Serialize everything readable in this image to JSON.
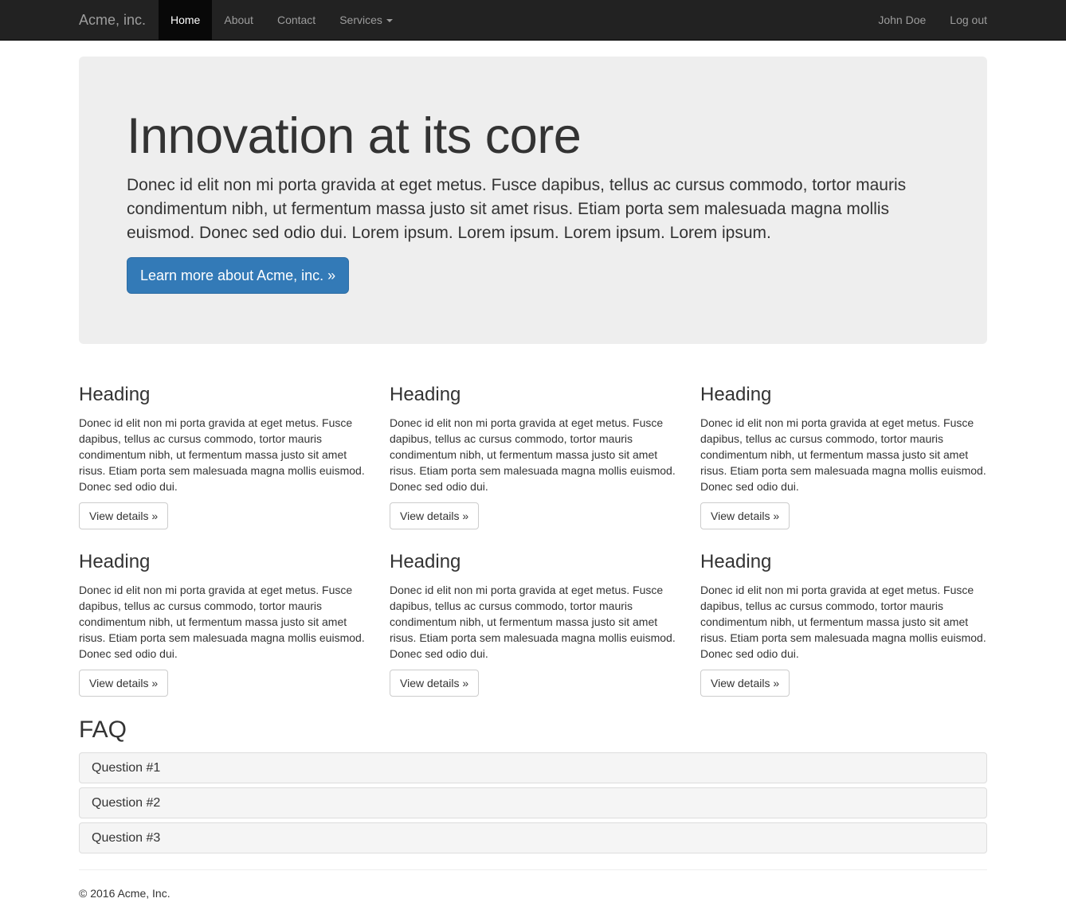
{
  "navbar": {
    "brand": "Acme, inc.",
    "items": [
      {
        "label": "Home"
      },
      {
        "label": "About"
      },
      {
        "label": "Contact"
      },
      {
        "label": "Services"
      }
    ],
    "right_items": [
      {
        "label": "John Doe"
      },
      {
        "label": "Log out"
      }
    ]
  },
  "jumbotron": {
    "title": "Innovation at its core",
    "text": "Donec id elit non mi porta gravida at eget metus. Fusce dapibus, tellus ac cursus commodo, tortor mauris condimentum nibh, ut fermentum massa justo sit amet risus. Etiam porta sem malesuada magna mollis euismod. Donec sed odio dui. Lorem ipsum. Lorem ipsum. Lorem ipsum. Lorem ipsum.",
    "button_label": "Learn more about Acme, inc. »"
  },
  "features": [
    {
      "heading": "Heading",
      "text": "Donec id elit non mi porta gravida at eget metus. Fusce dapibus, tellus ac cursus commodo, tortor mauris condimentum nibh, ut fermentum massa justo sit amet risus. Etiam porta sem malesuada magna mollis euismod. Donec sed odio dui.",
      "button_label": "View details »"
    },
    {
      "heading": "Heading",
      "text": "Donec id elit non mi porta gravida at eget metus. Fusce dapibus, tellus ac cursus commodo, tortor mauris condimentum nibh, ut fermentum massa justo sit amet risus. Etiam porta sem malesuada magna mollis euismod. Donec sed odio dui.",
      "button_label": "View details »"
    },
    {
      "heading": "Heading",
      "text": "Donec id elit non mi porta gravida at eget metus. Fusce dapibus, tellus ac cursus commodo, tortor mauris condimentum nibh, ut fermentum massa justo sit amet risus. Etiam porta sem malesuada magna mollis euismod. Donec sed odio dui.",
      "button_label": "View details »"
    },
    {
      "heading": "Heading",
      "text": "Donec id elit non mi porta gravida at eget metus. Fusce dapibus, tellus ac cursus commodo, tortor mauris condimentum nibh, ut fermentum massa justo sit amet risus. Etiam porta sem malesuada magna mollis euismod. Donec sed odio dui.",
      "button_label": "View details »"
    },
    {
      "heading": "Heading",
      "text": "Donec id elit non mi porta gravida at eget metus. Fusce dapibus, tellus ac cursus commodo, tortor mauris condimentum nibh, ut fermentum massa justo sit amet risus. Etiam porta sem malesuada magna mollis euismod. Donec sed odio dui.",
      "button_label": "View details »"
    },
    {
      "heading": "Heading",
      "text": "Donec id elit non mi porta gravida at eget metus. Fusce dapibus, tellus ac cursus commodo, tortor mauris condimentum nibh, ut fermentum massa justo sit amet risus. Etiam porta sem malesuada magna mollis euismod. Donec sed odio dui.",
      "button_label": "View details »"
    }
  ],
  "faq": {
    "title": "FAQ",
    "questions": [
      {
        "label": "Question #1"
      },
      {
        "label": "Question #2"
      },
      {
        "label": "Question #3"
      }
    ]
  },
  "footer": {
    "text": "© 2016 Acme, Inc."
  },
  "colors": {
    "navbar_bg": "#222222",
    "navbar_active_bg": "#080808",
    "primary": "#337ab7",
    "jumbotron_bg": "#eeeeee",
    "panel_heading_bg": "#f5f5f5"
  }
}
